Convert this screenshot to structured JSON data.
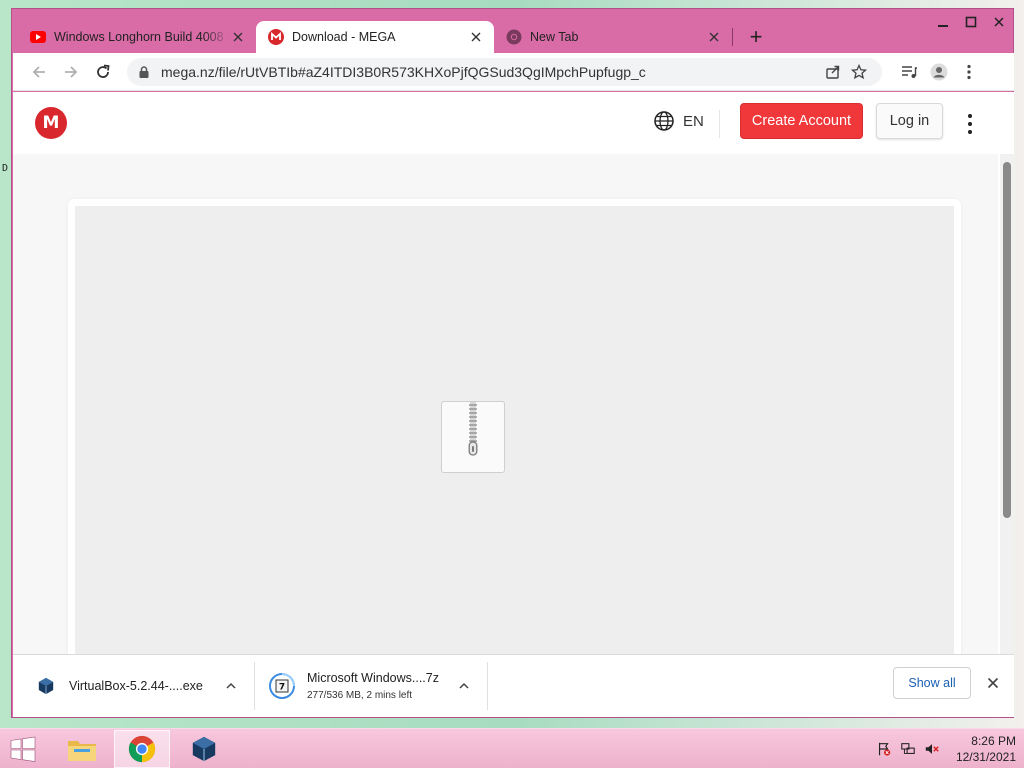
{
  "browser": {
    "tabs": [
      {
        "title": "Windows Longhorn Build 4008 - ",
        "icon": "youtube-icon",
        "active": false
      },
      {
        "title": "Download - MEGA",
        "icon": "mega-icon",
        "active": true
      },
      {
        "title": "New Tab",
        "icon": "chrome-icon",
        "active": false
      }
    ],
    "new_tab_label": "+",
    "url": "mega.nz/file/rUtVBTIb#aZ4ITDI3B0R573KHXoPjfQGSud3QgIMpchPupfugp_c"
  },
  "mega": {
    "logo_letter": "M",
    "language": "EN",
    "create_account": "Create Account",
    "log_in": "Log in",
    "file_type_icon": "zip-archive-icon"
  },
  "downloads": {
    "items": [
      {
        "name": "VirtualBox-5.2.44-....exe",
        "status": "",
        "icon": "virtualbox-icon"
      },
      {
        "name": "Microsoft Windows....7z",
        "status": "277/536 MB, 2 mins left",
        "icon": "archive-file-icon"
      }
    ],
    "show_all": "Show all"
  },
  "taskbar": {
    "apps": [
      "file-explorer-icon",
      "chrome-icon",
      "virtualbox-icon"
    ],
    "time": "8:26 PM",
    "date": "12/31/2021"
  },
  "desktop": {
    "glyph": "D"
  },
  "colors": {
    "window_frame": "#d96ca7",
    "mega_red": "#d9272e",
    "create_button": "#f0373a",
    "taskbar": "#eeb1cc"
  }
}
